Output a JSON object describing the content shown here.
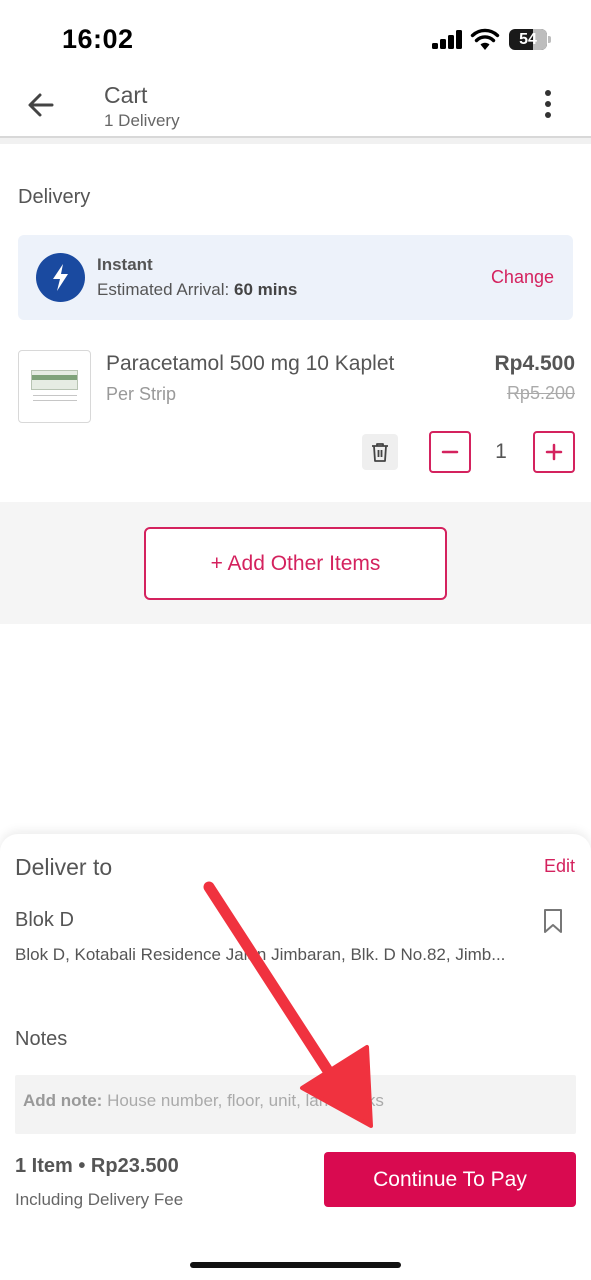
{
  "status_bar": {
    "time": "16:02",
    "battery": "54"
  },
  "header": {
    "title": "Cart",
    "subtitle": "1 Delivery"
  },
  "delivery": {
    "section_title": "Delivery",
    "type": "Instant",
    "eta_label": "Estimated Arrival:",
    "eta_value": "60 mins",
    "change_label": "Change"
  },
  "item": {
    "name": "Paracetamol 500 mg 10 Kaplet",
    "unit": "Per Strip",
    "price": "Rp4.500",
    "original_price": "Rp5.200",
    "quantity": "1"
  },
  "add_items_label": "+ Add Other Items",
  "sheet": {
    "deliver_to_title": "Deliver to",
    "edit_label": "Edit",
    "address_name": "Blok D",
    "address_full": "Blok D, Kotabali Residence Jalan Jimbaran, Blk. D No.82, Jimb...",
    "notes_title": "Notes",
    "note_label": "Add note:",
    "note_placeholder": "House number, floor, unit, landmarks",
    "total": "1 Item • Rp23.500",
    "fee_note": "Including Delivery Fee",
    "pay_label": "Continue To Pay"
  },
  "colors": {
    "accent": "#d4225e",
    "pay_button": "#d90a50",
    "instant_icon_bg": "#1a4aa0",
    "delivery_card_bg": "#edf2fa",
    "annotation_arrow": "#f0323f"
  },
  "icons": [
    "back-arrow-icon",
    "more-vertical-icon",
    "lightning-icon",
    "trash-icon",
    "minus-icon",
    "plus-icon",
    "bookmark-icon"
  ]
}
